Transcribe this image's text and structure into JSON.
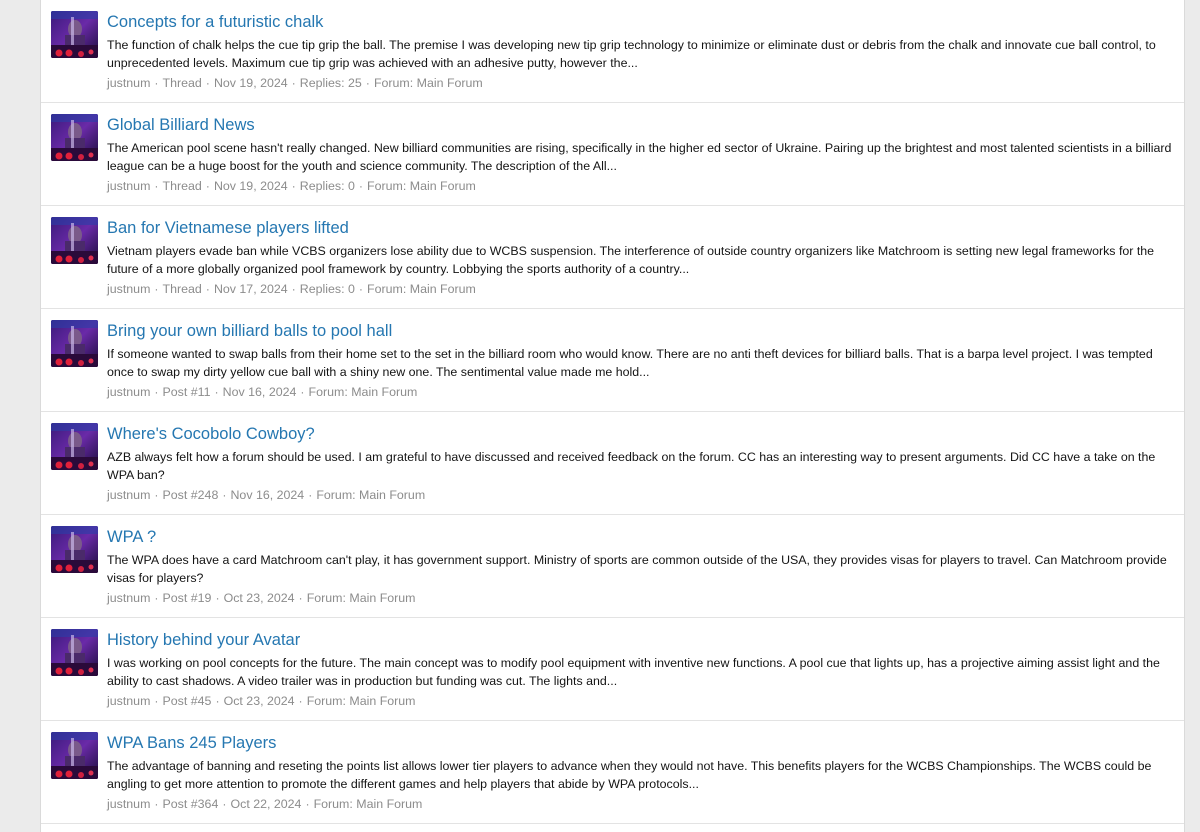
{
  "results": [
    {
      "title": "Concepts for a futuristic chalk",
      "snippet": "The function of chalk helps the cue tip grip the ball. The premise I was developing new tip grip technology to minimize or eliminate dust or debris from the chalk and innovate cue ball control, to unprecedented levels. Maximum cue tip grip was achieved with an adhesive putty, however the...",
      "author": "justnum",
      "type": "Thread",
      "date": "Nov 19, 2024",
      "extra": "Replies: 25",
      "forum_label": "Forum:",
      "forum": "Main Forum"
    },
    {
      "title": "Global Billiard News",
      "snippet": "The American pool scene hasn't really changed. New billiard communities are rising, specifically in the higher ed sector of Ukraine. Pairing up the brightest and most talented scientists in a billiard league can be a huge boost for the youth and science community. The description of the All...",
      "author": "justnum",
      "type": "Thread",
      "date": "Nov 19, 2024",
      "extra": "Replies: 0",
      "forum_label": "Forum:",
      "forum": "Main Forum"
    },
    {
      "title": "Ban for Vietnamese players lifted",
      "snippet": "Vietnam players evade ban while VCBS organizers lose ability due to WCBS suspension. The interference of outside country organizers like Matchroom is setting new legal frameworks for the future of a more globally organized pool framework by country. Lobbying the sports authority of a country...",
      "author": "justnum",
      "type": "Thread",
      "date": "Nov 17, 2024",
      "extra": "Replies: 0",
      "forum_label": "Forum:",
      "forum": "Main Forum"
    },
    {
      "title": "Bring your own billiard balls to pool hall",
      "snippet": "If someone wanted to swap balls from their home set to the set in the billiard room who would know. There are no anti theft devices for billiard balls. That is a barpa level project. I was tempted once to swap my dirty yellow cue ball with a shiny new one. The sentimental value made me hold...",
      "author": "justnum",
      "type": "Post #11",
      "date": "Nov 16, 2024",
      "extra": "",
      "forum_label": "Forum:",
      "forum": "Main Forum"
    },
    {
      "title": "Where's Cocobolo Cowboy?",
      "snippet": "AZB always felt how a forum should be used. I am grateful to have discussed and received feedback on the forum. CC has an interesting way to present arguments. Did CC have a take on the WPA ban?",
      "author": "justnum",
      "type": "Post #248",
      "date": "Nov 16, 2024",
      "extra": "",
      "forum_label": "Forum:",
      "forum": "Main Forum"
    },
    {
      "title": "WPA ?",
      "snippet": "The WPA does have a card Matchroom can't play, it has government support. Ministry of sports are common outside of the USA, they provides visas for players to travel. Can Matchroom provide visas for players?",
      "author": "justnum",
      "type": "Post #19",
      "date": "Oct 23, 2024",
      "extra": "",
      "forum_label": "Forum:",
      "forum": "Main Forum"
    },
    {
      "title": "History behind your Avatar",
      "snippet": "I was working on pool concepts for the future. The main concept was to modify pool equipment with inventive new functions. A pool cue that lights up, has a projective aiming assist light and the ability to cast shadows. A video trailer was in production but funding was cut. The lights and...",
      "author": "justnum",
      "type": "Post #45",
      "date": "Oct 23, 2024",
      "extra": "",
      "forum_label": "Forum:",
      "forum": "Main Forum"
    },
    {
      "title": "WPA Bans 245 Players",
      "snippet": "The advantage of banning and reseting the points list allows lower tier players to advance when they would not have. This benefits players for the WCBS Championships. The WCBS could be angling to get more attention to promote the different games and help players that abide by WPA protocols...",
      "author": "justnum",
      "type": "Post #364",
      "date": "Oct 22, 2024",
      "extra": "",
      "forum_label": "Forum:",
      "forum": "Main Forum"
    }
  ],
  "separator": "·",
  "colors": {
    "title": "#2577b1",
    "meta": "#8c8c8c",
    "text": "#141414"
  }
}
